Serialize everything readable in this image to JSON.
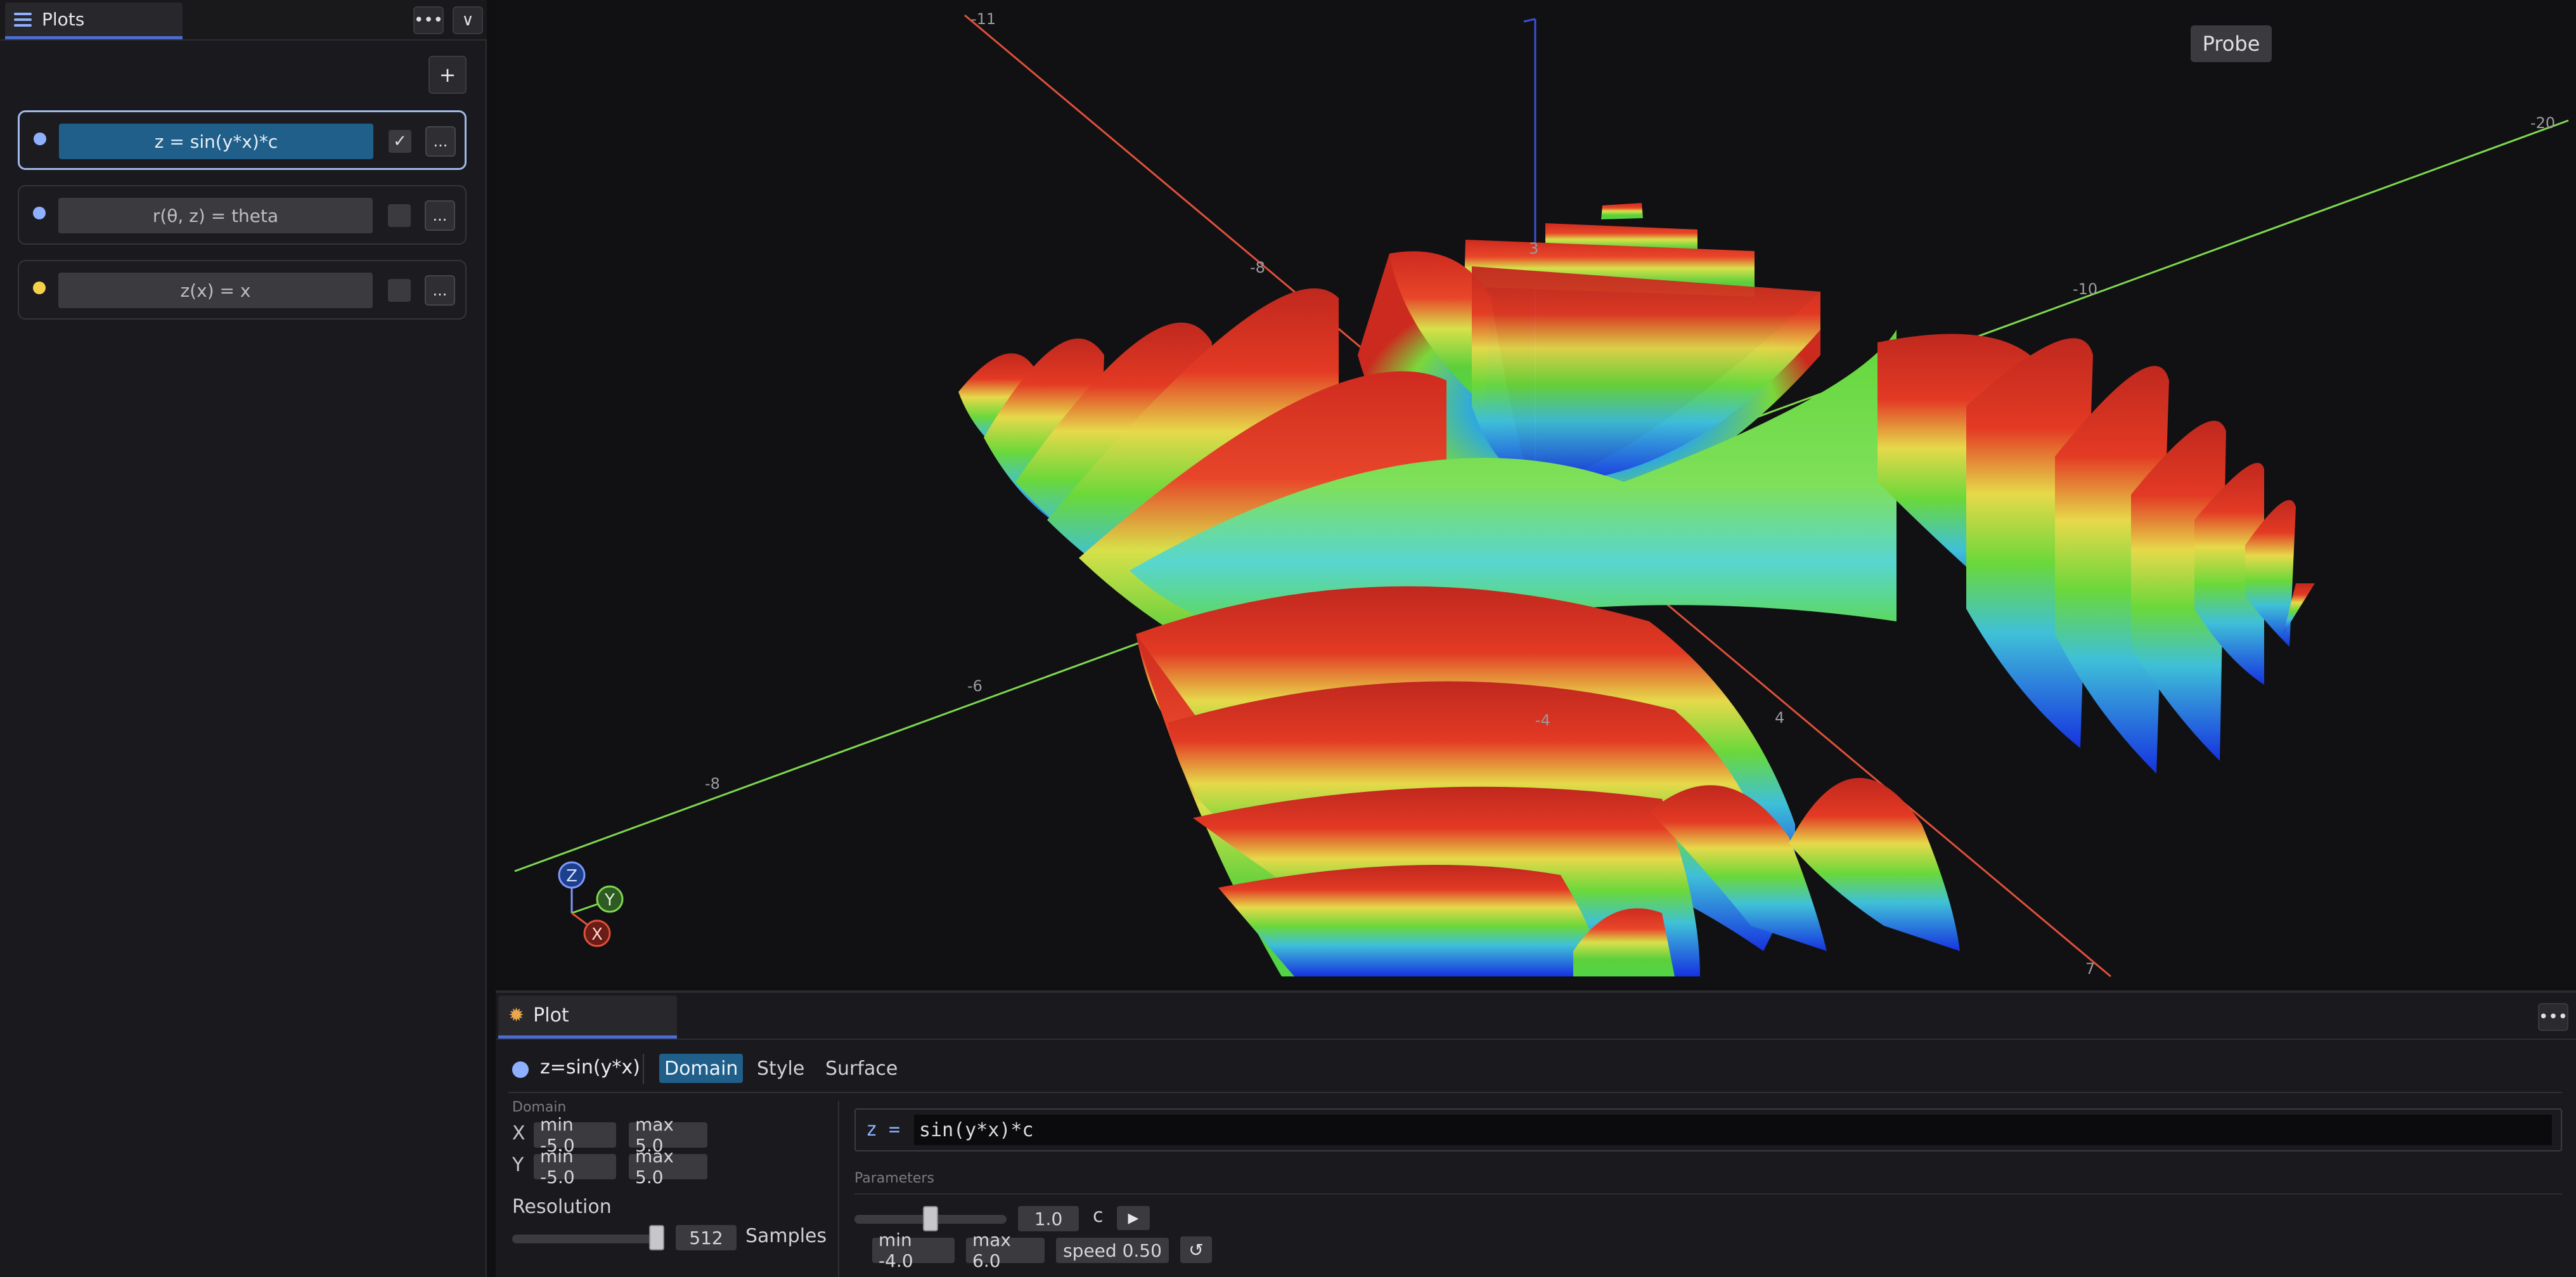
{
  "sidebar": {
    "tab_label": "Plots",
    "more_label": "•••",
    "collapse_label": "∨",
    "add_label": "+",
    "plots": [
      {
        "expression": "z = sin(y*x)*c",
        "checked": "✓",
        "more_label": "...",
        "color": "#8fb0ff",
        "selected": true
      },
      {
        "expression": "r(θ, z) = theta",
        "checked": "",
        "more_label": "...",
        "color": "#8fb0ff",
        "selected": false
      },
      {
        "expression": "z(x) = x",
        "checked": "",
        "more_label": "...",
        "color": "#f5d14a",
        "selected": false
      }
    ]
  },
  "viewport": {
    "probe_label": "Probe",
    "axes": {
      "x_color": "#e0503a",
      "y_color": "#7fd84e",
      "z_color": "#3b4fd8",
      "tick_labels": {
        "red_top": "-11",
        "red_upper": "-8",
        "red_lower": "4",
        "red_bottom": "7",
        "green_far": "-20",
        "green_upper": "-10",
        "green_mid": "-6",
        "green_low": "-8",
        "center_low": "-4",
        "z_mid": "3"
      }
    },
    "gizmo": {
      "z": "Z",
      "y": "Y",
      "x": "X"
    }
  },
  "bottom_panel": {
    "tab_label": "Plot",
    "more_label": "•••",
    "plot_name": "z=sin(y*x)",
    "subtabs": [
      "Domain",
      "Style",
      "Surface"
    ],
    "active_subtab": "Domain",
    "domain": {
      "section_label": "Domain",
      "x_label": "X",
      "x_min": "min -5.0",
      "x_max": "max 5.0",
      "y_label": "Y",
      "y_min": "min -5.0",
      "y_max": "max 5.0",
      "resolution_label": "Resolution",
      "resolution_value": "512",
      "samples_label": "Samples",
      "resolution_fraction": 1.0
    },
    "expression": {
      "lhs": "z",
      "eq": "=",
      "value": "sin(y*x)*c"
    },
    "parameters": {
      "section_label": "Parameters",
      "name": "c",
      "value": "1.0",
      "min": "min -4.0",
      "max": "max 6.0",
      "speed": "speed 0.50",
      "play_label": "▶",
      "reset_label": "↺",
      "value_fraction": 0.5
    }
  }
}
